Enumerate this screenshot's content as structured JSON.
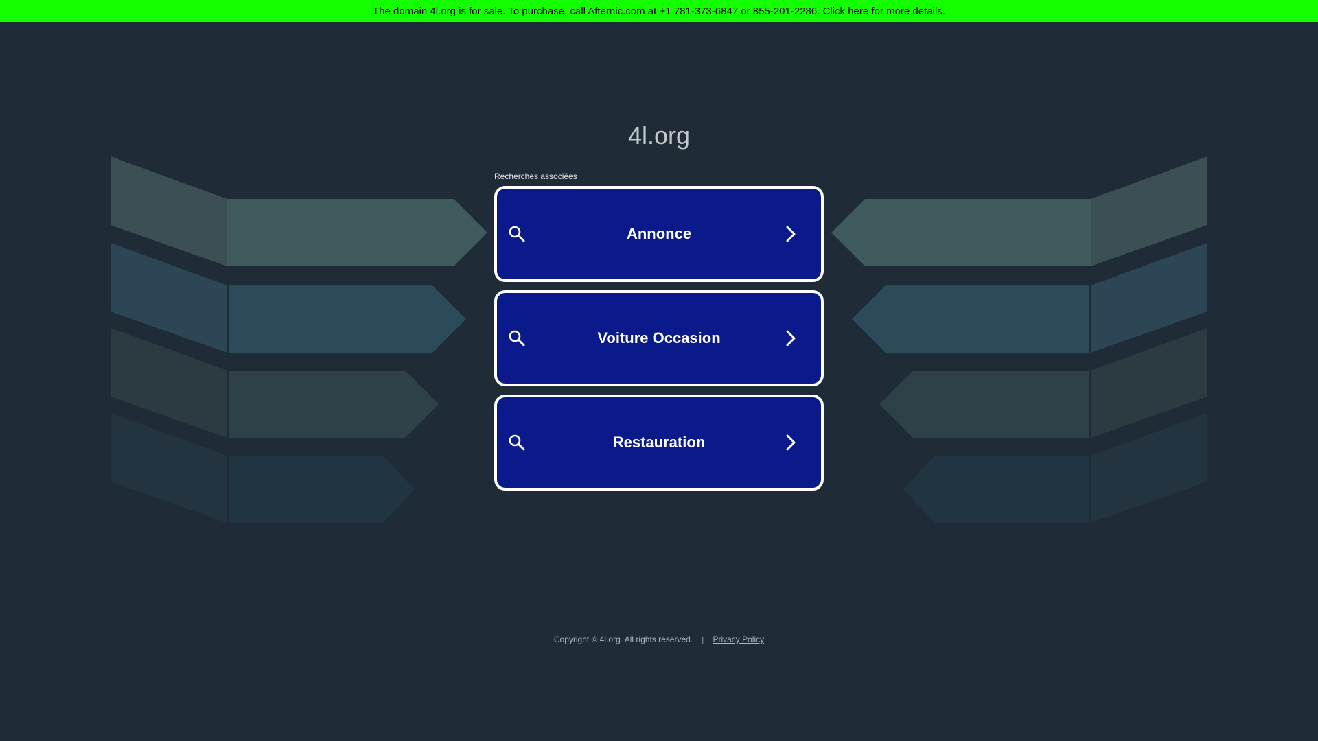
{
  "banner": {
    "text": "The domain 4l.org is for sale. To purchase, call Afternic.com at +1 781-373-6847 or 855-201-2286. Click here for more details.",
    "background": "#14ff00"
  },
  "domain_title": "4l.org",
  "related": {
    "label": "Recherches associées",
    "items": [
      {
        "label": "Annonce",
        "icon": "search-icon",
        "arrow": "chevron-right-icon"
      },
      {
        "label": "Voiture Occasion",
        "icon": "search-icon",
        "arrow": "chevron-right-icon"
      },
      {
        "label": "Restauration",
        "icon": "search-icon",
        "arrow": "chevron-right-icon"
      }
    ],
    "button_color": "#0a1a8a"
  },
  "footer": {
    "copyright": "Copyright © 4l.org.  All rights reserved.",
    "separator": "|",
    "privacy_label": "Privacy Policy"
  },
  "colors": {
    "page_background": "#1f2b36",
    "accent": "#14ff00"
  }
}
